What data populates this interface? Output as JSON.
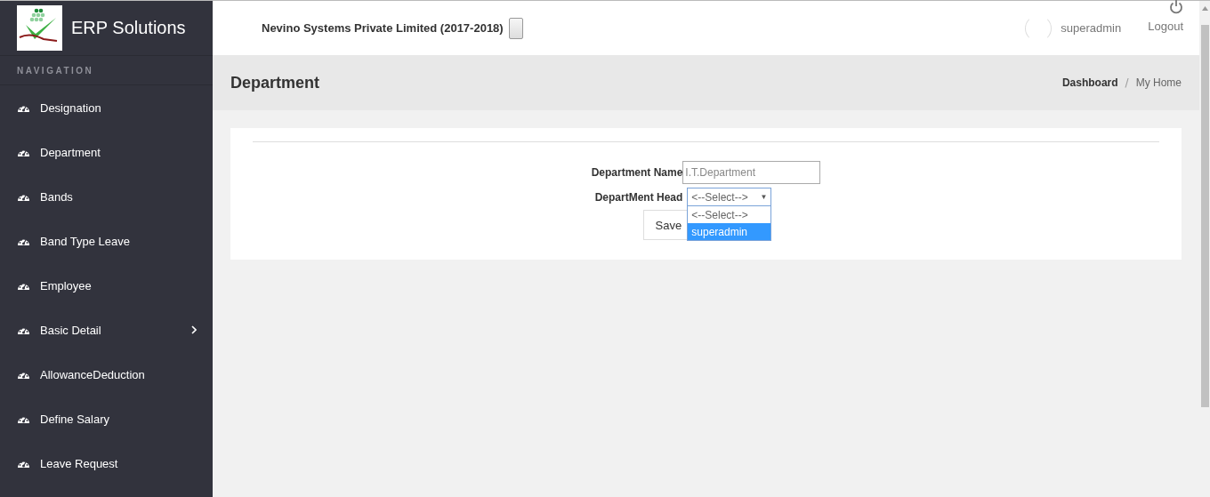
{
  "brand": {
    "title": "ERP Solutions"
  },
  "sidebar": {
    "heading": "NAVIGATION",
    "items": [
      {
        "label": "Designation",
        "expandable": false
      },
      {
        "label": "Department",
        "expandable": false
      },
      {
        "label": "Bands",
        "expandable": false
      },
      {
        "label": "Band Type Leave",
        "expandable": false
      },
      {
        "label": "Employee",
        "expandable": false
      },
      {
        "label": "Basic Detail",
        "expandable": true
      },
      {
        "label": "AllowanceDeduction",
        "expandable": false
      },
      {
        "label": "Define Salary",
        "expandable": false
      },
      {
        "label": "Leave Request",
        "expandable": false
      }
    ]
  },
  "header": {
    "company": "Nevino Systems Private Limited (2017-2018)",
    "user": "superadmin",
    "logout": "Logout"
  },
  "page": {
    "title": "Department",
    "breadcrumb": [
      "Dashboard",
      "My Home"
    ],
    "breadcrumb_separator": "/"
  },
  "form": {
    "name_label": "Department Name",
    "name_value": "I.T.Department",
    "head_label": "DepartMent Head",
    "head_value": "<--Select-->",
    "head_arrow": "▼",
    "options": [
      {
        "label": "<--Select-->",
        "selected": false
      },
      {
        "label": "superadmin",
        "selected": true
      }
    ],
    "save": "Save"
  }
}
